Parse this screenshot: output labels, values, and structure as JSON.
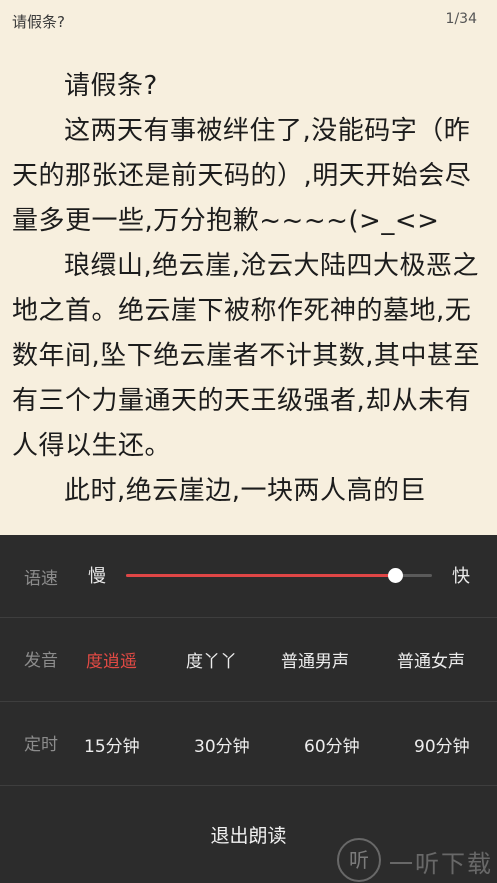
{
  "header": {
    "title": "请假条?",
    "page_indicator": "1/34"
  },
  "content": {
    "paragraphs": [
      "请假条?",
      "这两天有事被绊住了,没能码字（昨天的那张还是前天码的）,明天开始会尽量多更一些,万分抱歉~~~~(>_<>",
      "琅缳山,绝云崖,沧云大陆四大极恶之地之首。绝云崖下被称作死神的墓地,无数年间,坠下绝云崖者不计其数,其中甚至有三个力量通天的天王级强者,却从未有人得以生还。",
      "此时,绝云崖边,一块两人高的巨"
    ]
  },
  "controls": {
    "speed": {
      "label": "语速",
      "slow_label": "慢",
      "fast_label": "快",
      "value_fraction": 0.88,
      "fill_color": "#e04646"
    },
    "voice": {
      "label": "发音",
      "options": [
        "度逍遥",
        "度丫丫",
        "普通男声",
        "普通女声"
      ],
      "selected": "度逍遥",
      "accent_color": "#e24a44"
    },
    "timer": {
      "label": "定时",
      "options": [
        "15分钟",
        "30分钟",
        "60分钟",
        "90分钟"
      ]
    },
    "exit_label": "退出朗读"
  },
  "watermark": {
    "logo_glyph": "听",
    "text": "一听下载"
  }
}
